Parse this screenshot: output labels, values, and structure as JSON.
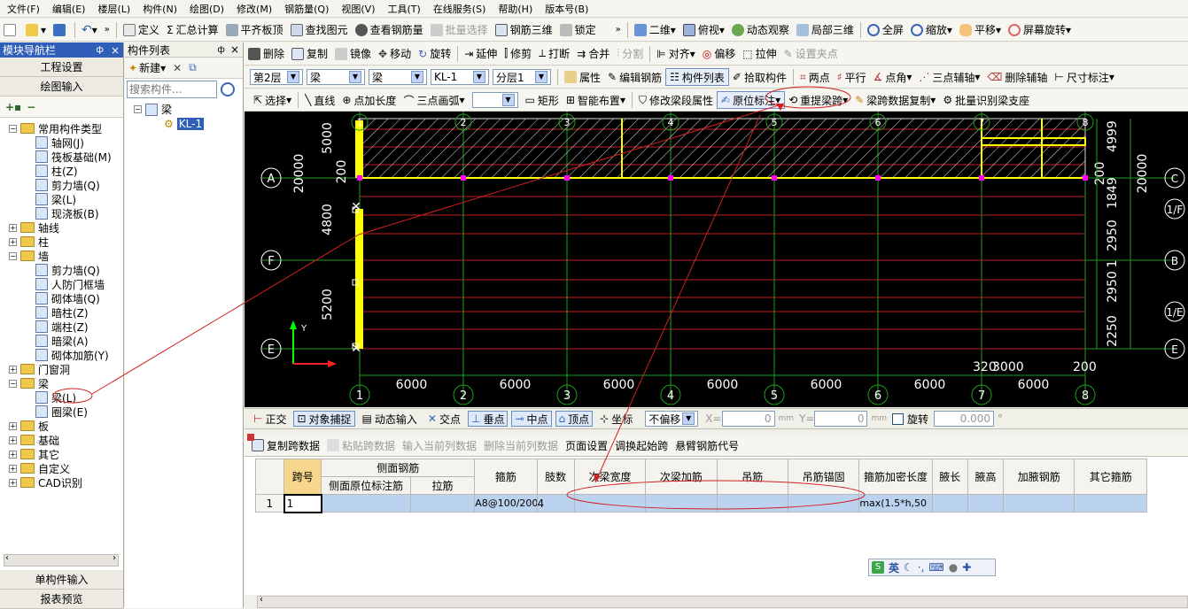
{
  "menu": [
    "文件(F)",
    "编辑(E)",
    "楼层(L)",
    "构件(N)",
    "绘图(D)",
    "修改(M)",
    "钢筋量(Q)",
    "视图(V)",
    "工具(T)",
    "在线服务(S)",
    "帮助(H)",
    "版本号(B)"
  ],
  "toolbar1": {
    "items": [
      "定义",
      "汇总计算",
      "平齐板顶",
      "查找图元",
      "查看钢筋量",
      "批量选择",
      "钢筋三维",
      "锁定"
    ],
    "view_mode": "二维",
    "right_items": [
      "俯视",
      "动态观察",
      "局部三维",
      "全屏",
      "缩放",
      "平移",
      "屏幕旋转"
    ]
  },
  "toolbar2": {
    "items": [
      "删除",
      "复制",
      "镜像",
      "移动",
      "旋转",
      "延伸",
      "修剪",
      "打断",
      "合并",
      "分割",
      "对齐",
      "偏移",
      "拉伸",
      "设置夹点"
    ]
  },
  "toolbar3": {
    "floor": "第2层",
    "category": "梁",
    "type": "梁",
    "component": "KL-1",
    "layer": "分层1",
    "items": [
      "属性",
      "编辑钢筋",
      "构件列表",
      "拾取构件",
      "两点",
      "平行",
      "点角",
      "三点辅轴",
      "删除辅轴",
      "尺寸标注"
    ]
  },
  "toolbar4": {
    "items": [
      "选择",
      "直线",
      "点加长度",
      "三点画弧",
      "矩形",
      "智能布置",
      "修改梁段属性",
      "原位标注",
      "重提梁跨",
      "梁跨数据复制",
      "批量识别梁支座"
    ]
  },
  "nav": {
    "title": "模块导航栏",
    "pin": "ф",
    "close": "×",
    "buttons": [
      "工程设置",
      "绘图输入"
    ],
    "bottom_buttons": [
      "单构件输入",
      "报表预览"
    ],
    "tree": [
      {
        "label": "常用构件类型",
        "level": 0,
        "type": "folder",
        "expanded": true
      },
      {
        "label": "轴网(J)",
        "level": 1,
        "type": "item"
      },
      {
        "label": "筏板基础(M)",
        "level": 1,
        "type": "item"
      },
      {
        "label": "柱(Z)",
        "level": 1,
        "type": "item"
      },
      {
        "label": "剪力墙(Q)",
        "level": 1,
        "type": "item"
      },
      {
        "label": "梁(L)",
        "level": 1,
        "type": "item"
      },
      {
        "label": "现浇板(B)",
        "level": 1,
        "type": "item"
      },
      {
        "label": "轴线",
        "level": 0,
        "type": "folder",
        "expanded": false
      },
      {
        "label": "柱",
        "level": 0,
        "type": "folder",
        "expanded": false
      },
      {
        "label": "墙",
        "level": 0,
        "type": "folder",
        "expanded": true
      },
      {
        "label": "剪力墙(Q)",
        "level": 1,
        "type": "item"
      },
      {
        "label": "人防门框墙",
        "level": 1,
        "type": "item"
      },
      {
        "label": "砌体墙(Q)",
        "level": 1,
        "type": "item"
      },
      {
        "label": "暗柱(Z)",
        "level": 1,
        "type": "item"
      },
      {
        "label": "端柱(Z)",
        "level": 1,
        "type": "item"
      },
      {
        "label": "暗梁(A)",
        "level": 1,
        "type": "item"
      },
      {
        "label": "砌体加筋(Y)",
        "level": 1,
        "type": "item"
      },
      {
        "label": "门窗洞",
        "level": 0,
        "type": "folder",
        "expanded": false
      },
      {
        "label": "梁",
        "level": 0,
        "type": "folder",
        "expanded": true
      },
      {
        "label": "梁(L)",
        "level": 1,
        "type": "item"
      },
      {
        "label": "圈梁(E)",
        "level": 1,
        "type": "item"
      },
      {
        "label": "板",
        "level": 0,
        "type": "folder",
        "expanded": false
      },
      {
        "label": "基础",
        "level": 0,
        "type": "folder",
        "expanded": false
      },
      {
        "label": "其它",
        "level": 0,
        "type": "folder",
        "expanded": false
      },
      {
        "label": "自定义",
        "level": 0,
        "type": "folder",
        "expanded": false
      },
      {
        "label": "CAD识别",
        "level": 0,
        "type": "folder",
        "expanded": false
      }
    ]
  },
  "component_list": {
    "title": "构件列表",
    "new_label": "新建",
    "search_placeholder": "搜索构件...",
    "root": "梁",
    "child": "KL-1"
  },
  "cad": {
    "axis_numbers": [
      "1",
      "2",
      "3",
      "4",
      "5",
      "6",
      "7",
      "8"
    ],
    "spans": [
      "6000",
      "6000",
      "6000",
      "6000",
      "6000",
      "6000",
      "6000"
    ],
    "top_dims": [
      "5000",
      "200"
    ],
    "left_dims": [
      "20000",
      "4800",
      "5200"
    ],
    "right_dims": [
      "4999",
      "200",
      "1849",
      "2950",
      "1",
      "2950",
      "2250"
    ],
    "right_total": "20000",
    "row_labels_left": [
      "A",
      "F",
      "E"
    ],
    "row_labels_right": [
      "1/F",
      "B",
      "1/E",
      "C"
    ],
    "bottom_small": [
      "320",
      "3000",
      "200"
    ]
  },
  "snap": {
    "items": [
      "正交",
      "对象捕捉",
      "动态输入",
      "交点",
      "垂点",
      "中点",
      "顶点",
      "坐标"
    ],
    "offset_mode": "不偏移",
    "x_label": "X=",
    "x_value": "0",
    "y_label": "Y=",
    "y_value": "0",
    "unit": "mm",
    "rotate_label": "旋转",
    "rotate_value": "0.000"
  },
  "span_toolbar": [
    "复制跨数据",
    "粘贴跨数据",
    "输入当前列数据",
    "删除当前列数据",
    "页面设置",
    "调换起始跨",
    "悬臂钢筋代号"
  ],
  "span_table": {
    "headers": [
      "跨号",
      "侧面钢筋",
      "箍筋",
      "肢数",
      "次梁宽度",
      "次梁加筋",
      "吊筋",
      "吊筋锚固",
      "箍筋加密长度",
      "腋长",
      "腋高",
      "加腋钢筋",
      "其它箍筋"
    ],
    "sub_headers": [
      "侧面原位标注筋",
      "拉筋"
    ],
    "rows": [
      [
        "1",
        "1",
        "",
        "",
        "A8@100/200(",
        "4",
        "",
        "",
        "",
        "",
        "max(1.5*h,50",
        "",
        "",
        "",
        ""
      ]
    ]
  },
  "ime": {
    "lang": "英"
  }
}
